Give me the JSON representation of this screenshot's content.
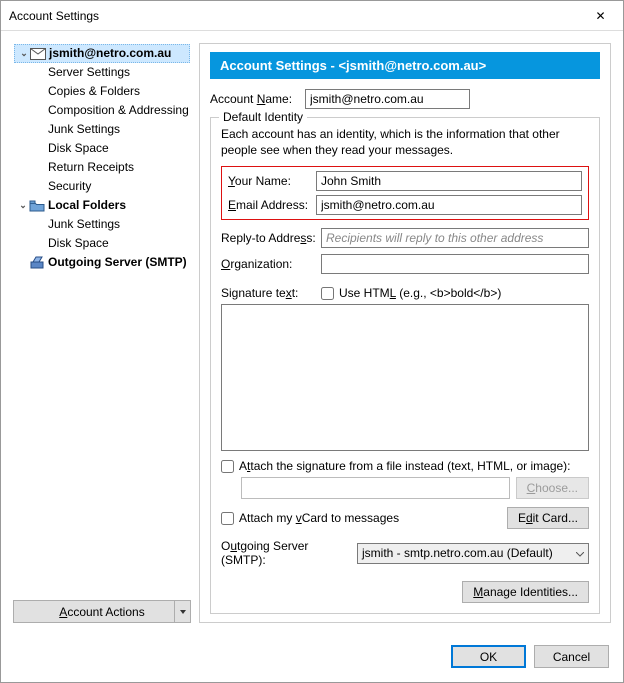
{
  "window": {
    "title": "Account Settings",
    "close": "✕"
  },
  "tree": {
    "account": "jsmith@netro.com.au",
    "items": [
      "Server Settings",
      "Copies & Folders",
      "Composition & Addressing",
      "Junk Settings",
      "Disk Space",
      "Return Receipts",
      "Security"
    ],
    "localFolders": "Local Folders",
    "lfItems": [
      "Junk Settings",
      "Disk Space"
    ],
    "smtp": "Outgoing Server (SMTP)"
  },
  "accountActions": "Account Actions",
  "header": "Account Settings - <jsmith@netro.com.au>",
  "acctName": {
    "label": "Account Name:",
    "value": "jsmith@netro.com.au"
  },
  "identity": {
    "legend": "Default Identity",
    "desc": "Each account has an identity, which is the information that other people see when they read your messages.",
    "name": {
      "label": "Your Name:",
      "value": "John Smith"
    },
    "email": {
      "label": "Email Address:",
      "value": "jsmith@netro.com.au"
    },
    "replyTo": {
      "label": "Reply-to Address:",
      "placeholder": "Recipients will reply to this other address",
      "value": ""
    },
    "org": {
      "label": "Organization:",
      "value": ""
    },
    "sig": {
      "label": "Signature text:",
      "useHtml": "Use HTML (e.g., <b>bold</b>)"
    },
    "attachSig": "Attach the signature from a file instead (text, HTML, or image):",
    "choose": "Choose...",
    "vcard": "Attach my vCard to messages",
    "editCard": "Edit Card...",
    "smtp": {
      "label": "Outgoing Server (SMTP):",
      "value": "jsmith - smtp.netro.com.au (Default)"
    },
    "manage": "Manage Identities..."
  },
  "buttons": {
    "ok": "OK",
    "cancel": "Cancel"
  }
}
